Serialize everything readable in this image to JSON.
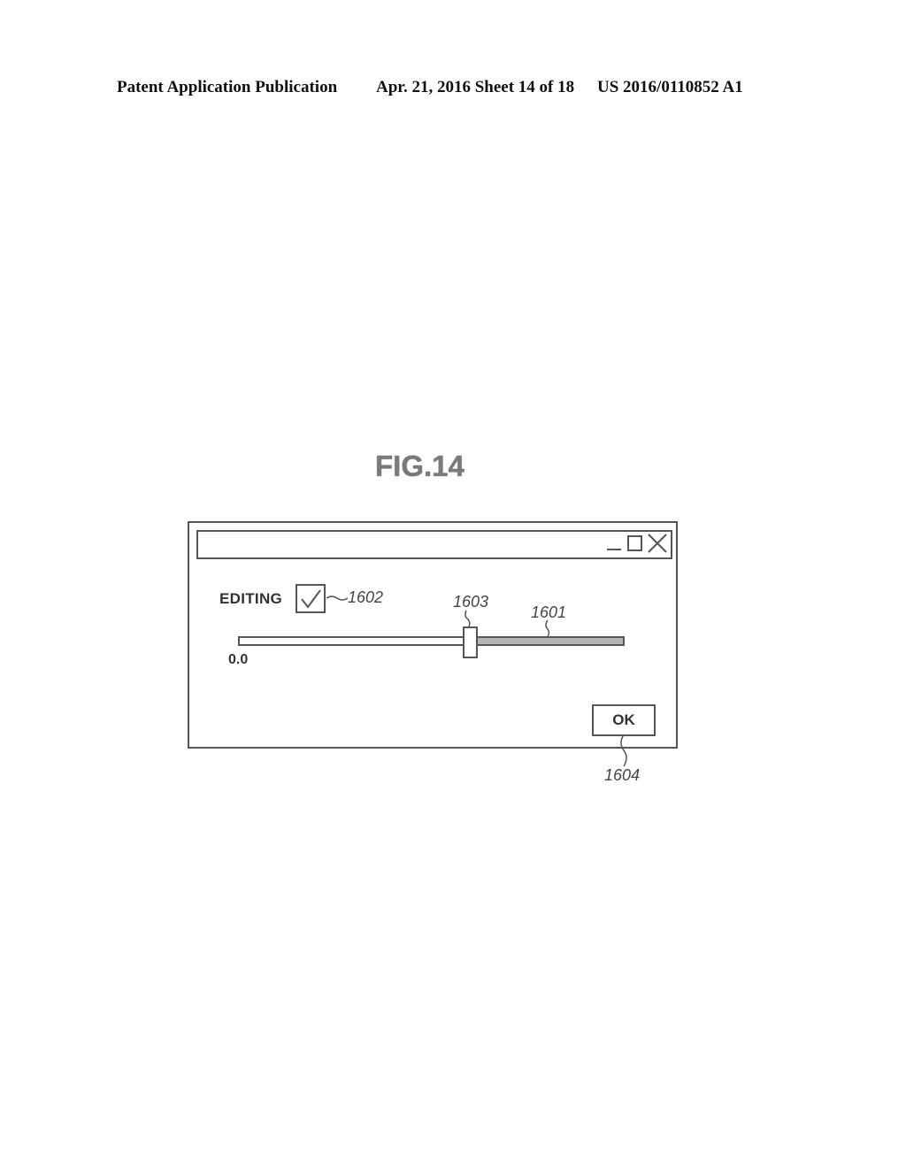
{
  "header": {
    "publication": "Patent Application Publication",
    "date_sheet": "Apr. 21, 2016  Sheet 14 of 18",
    "number": "US 2016/0110852 A1"
  },
  "figure": {
    "title": "FIG.14"
  },
  "dialog": {
    "titlebar": {
      "title": "",
      "buttons": [
        "minimize-icon",
        "maximize-icon",
        "close-icon"
      ]
    },
    "editing": {
      "label": "EDITING",
      "checked": true,
      "ref": "1602"
    },
    "slider": {
      "min_label": "0.0",
      "value_fraction": 0.6,
      "track_ref": "1601",
      "thumb_ref": "1603"
    },
    "ok_button": {
      "label": "OK",
      "ref": "1604"
    }
  }
}
